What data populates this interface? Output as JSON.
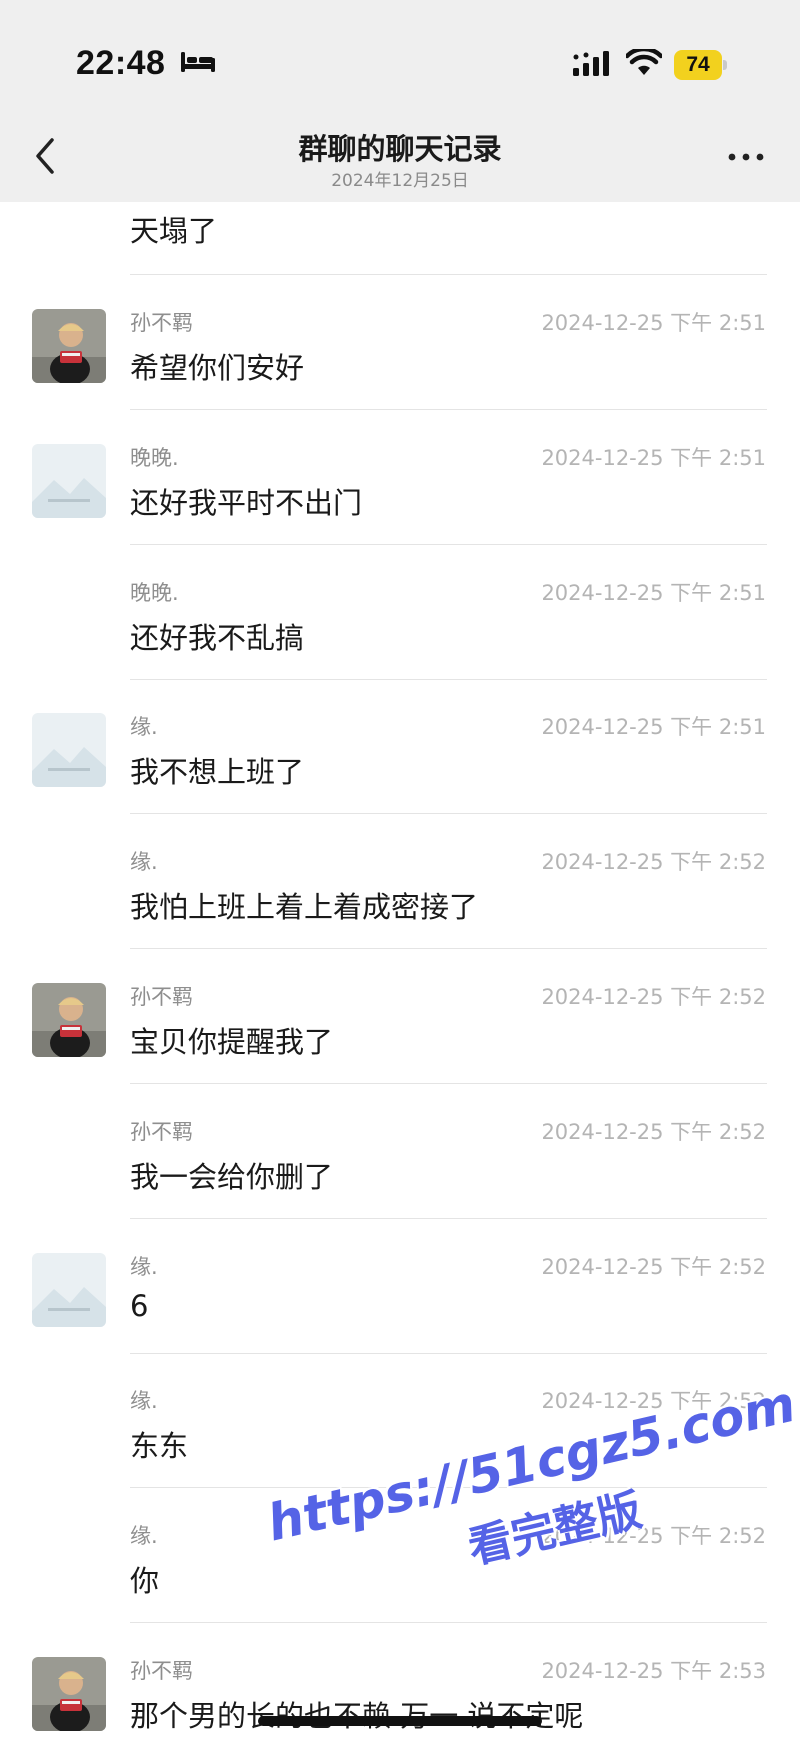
{
  "status_bar": {
    "time": "22:48",
    "battery": "74",
    "colors": {
      "battery": "#f2d11e",
      "background": "#efefef"
    },
    "icons": [
      "bed-icon",
      "signal-icon",
      "wifi-icon",
      "battery-icon"
    ]
  },
  "nav": {
    "title": "群聊的聊天记录",
    "subtitle": "2024年12月25日",
    "icons": [
      "back-chevron-icon",
      "more-dots-icon"
    ]
  },
  "first_message": {
    "text": "天塌了"
  },
  "messages": [
    {
      "sender": "孙不羁",
      "time": "2024-12-25 下午 2:51",
      "text": "希望你们安好",
      "avatar": "photo"
    },
    {
      "sender": "晚晚.",
      "time": "2024-12-25 下午 2:51",
      "text": "还好我平时不出门",
      "avatar": "placeholder"
    },
    {
      "sender": "晚晚.",
      "time": "2024-12-25 下午 2:51",
      "text": "还好我不乱搞",
      "avatar": "none"
    },
    {
      "sender": "缘.",
      "time": "2024-12-25 下午 2:51",
      "text": "我不想上班了",
      "avatar": "placeholder"
    },
    {
      "sender": "缘.",
      "time": "2024-12-25 下午 2:52",
      "text": "我怕上班上着上着成密接了",
      "avatar": "none"
    },
    {
      "sender": "孙不羁",
      "time": "2024-12-25 下午 2:52",
      "text": "宝贝你提醒我了",
      "avatar": "photo"
    },
    {
      "sender": "孙不羁",
      "time": "2024-12-25 下午 2:52",
      "text": "我一会给你删了",
      "avatar": "none"
    },
    {
      "sender": "缘.",
      "time": "2024-12-25 下午 2:52",
      "text": "6",
      "avatar": "placeholder"
    },
    {
      "sender": "缘.",
      "time": "2024-12-25 下午 2:52",
      "text": "东东",
      "avatar": "none"
    },
    {
      "sender": "缘.",
      "time": "2024-12-25 下午 2:52",
      "text": "你",
      "avatar": "none"
    },
    {
      "sender": "孙不羁",
      "time": "2024-12-25 下午 2:53",
      "text": "那个男的长的也不赖 万一 说不定呢",
      "avatar": "photo"
    }
  ],
  "watermark": {
    "url": "https://51cgz5.com",
    "text": "看完整版",
    "color": "#5563e6"
  }
}
